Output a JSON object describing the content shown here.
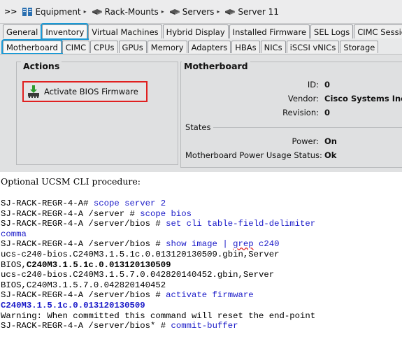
{
  "breadcrumb": {
    "prefix": ">>",
    "items": [
      "Equipment",
      "Rack-Mounts",
      "Servers",
      "Server 11"
    ]
  },
  "tabs_primary": [
    "General",
    "Inventory",
    "Virtual Machines",
    "Hybrid Display",
    "Installed Firmware",
    "SEL Logs",
    "CIMC Session"
  ],
  "tabs_secondary": [
    "Motherboard",
    "CIMC",
    "CPUs",
    "GPUs",
    "Memory",
    "Adapters",
    "HBAs",
    "NICs",
    "iSCSI vNICs",
    "Storage"
  ],
  "actions": {
    "title": "Actions",
    "button_label": "Activate BIOS Firmware"
  },
  "motherboard": {
    "title": "Motherboard",
    "id_label": "ID:",
    "id_value": "0",
    "vendor_label": "Vendor:",
    "vendor_value": "Cisco Systems Inc",
    "revision_label": "Revision:",
    "revision_value": "0",
    "states_label": "States",
    "power_label": "Power:",
    "power_value": "On",
    "usage_label": "Motherboard Power Usage Status:",
    "usage_value": "Ok"
  },
  "doc": {
    "note": "Optional UCSM CLI procedure:",
    "lines": [
      {
        "prompt": "SJ-RACK-REGR-4-A# ",
        "cmd": "scope server 2"
      },
      {
        "prompt": "SJ-RACK-REGR-4-A /server # ",
        "cmd": "scope bios"
      },
      {
        "prompt": "SJ-RACK-REGR-4-A /server/bios # ",
        "cmd": "set cli table-field-delimiter"
      },
      {
        "prompt": "",
        "cmd": "comma"
      },
      {
        "prompt": "SJ-RACK-REGR-4-A /server/bios # ",
        "cmd": "show image | ",
        "cmd_squig": "grep",
        "cmd_tail": " c240"
      },
      {
        "text": "ucs-c240-bios.C240M3.1.5.1c.0.013120130509.gbin,Server"
      },
      {
        "text": "BIOS,",
        "bold": "C240M3.1.5.1c.0.013120130509"
      },
      {
        "text": "ucs-c240-bios.C240M3.1.5.7.0.042820140452.gbin,Server"
      },
      {
        "text": "BIOS,C240M3.1.5.7.0.042820140452"
      },
      {
        "prompt": "SJ-RACK-REGR-4-A /server/bios # ",
        "cmd": "activate firmware"
      },
      {
        "boldblue": "C240M3.1.5.1c.0.013120130509"
      },
      {
        "text": "Warning: When committed this command will reset the end-point"
      },
      {
        "prompt": "SJ-RACK-REGR-4-A /server/bios* # ",
        "cmd": "commit-buffer"
      }
    ]
  },
  "colors": {
    "highlight_tab": "#1a9ad6",
    "highlight_button": "#e02020",
    "cli_command": "#1a1ac8"
  }
}
